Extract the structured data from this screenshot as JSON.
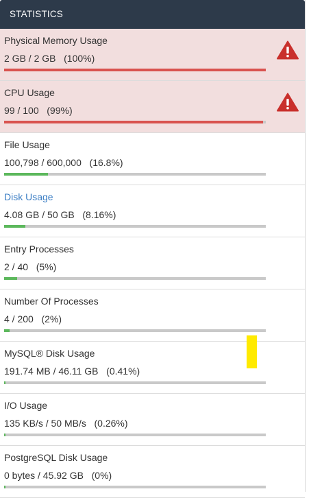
{
  "header": {
    "title": "STATISTICS"
  },
  "colors": {
    "danger": "#d9534f",
    "success": "#5cb85c",
    "link": "#3a7dc4"
  },
  "stats": [
    {
      "title": "Physical Memory Usage",
      "value": "2 GB / 2 GB   (100%)",
      "percent": 100,
      "status": "danger",
      "icon": "warning-icon"
    },
    {
      "title": "CPU Usage",
      "value": "99 / 100   (99%)",
      "percent": 99,
      "status": "danger",
      "icon": "warning-icon"
    },
    {
      "title": "File Usage",
      "value": "100,798 / 600,000   (16.8%)",
      "percent": 16.8,
      "status": "ok"
    },
    {
      "title": "Disk Usage",
      "value": "4.08 GB / 50 GB   (8.16%)",
      "percent": 8.16,
      "status": "ok",
      "link": true
    },
    {
      "title": "Entry Processes",
      "value": "2 / 40   (5%)",
      "percent": 5,
      "status": "ok"
    },
    {
      "title": "Number Of Processes",
      "value": "4 / 200   (2%)",
      "percent": 2,
      "status": "ok"
    },
    {
      "title": "MySQL® Disk Usage",
      "value": "191.74 MB / 46.11 GB   (0.41%)",
      "percent": 0.41,
      "status": "ok"
    },
    {
      "title": "I/O Usage",
      "value": "135 KB/s / 50 MB/s   (0.26%)",
      "percent": 0.26,
      "status": "ok"
    },
    {
      "title": "PostgreSQL Disk Usage",
      "value": "0 bytes / 45.92 GB   (0%)",
      "percent": 0,
      "status": "ok"
    }
  ]
}
